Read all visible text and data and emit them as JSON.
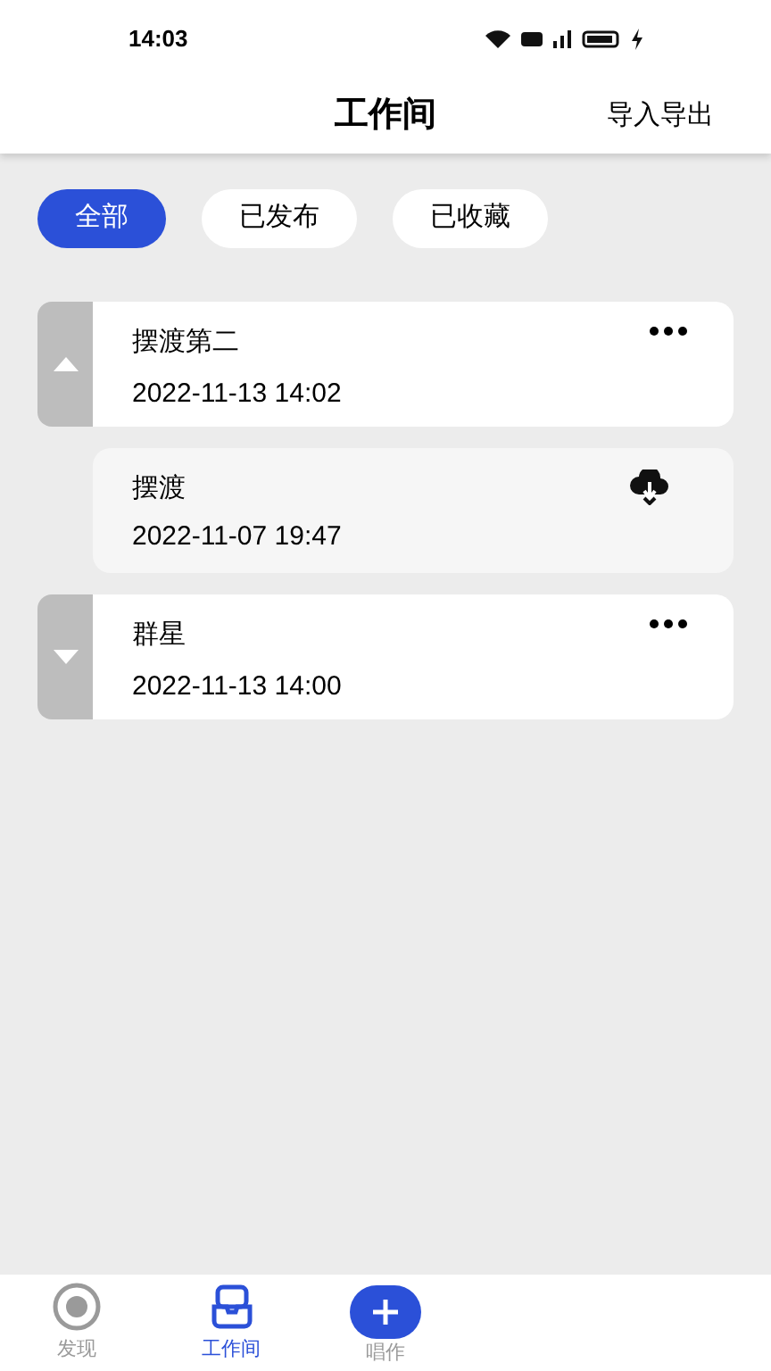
{
  "status_bar": {
    "time": "14:03"
  },
  "header": {
    "title": "工作间",
    "action": "导入导出"
  },
  "filters": [
    {
      "label": "全部",
      "selected": true
    },
    {
      "label": "已发布",
      "selected": false
    },
    {
      "label": "已收藏",
      "selected": false
    }
  ],
  "projects": [
    {
      "title": "摆渡第二",
      "time": "2022-11-13 14:02",
      "expanded": true,
      "children": [
        {
          "title": "摆渡",
          "time": "2022-11-07 19:47"
        }
      ]
    },
    {
      "title": "群星",
      "time": "2022-11-13 14:00",
      "expanded": false
    }
  ],
  "bottom_nav": [
    {
      "kind": "discover",
      "label": "发现",
      "selected": false
    },
    {
      "kind": "workspace",
      "label": "工作间",
      "selected": true
    },
    {
      "kind": "create",
      "label": "唱作",
      "selected": false
    }
  ]
}
